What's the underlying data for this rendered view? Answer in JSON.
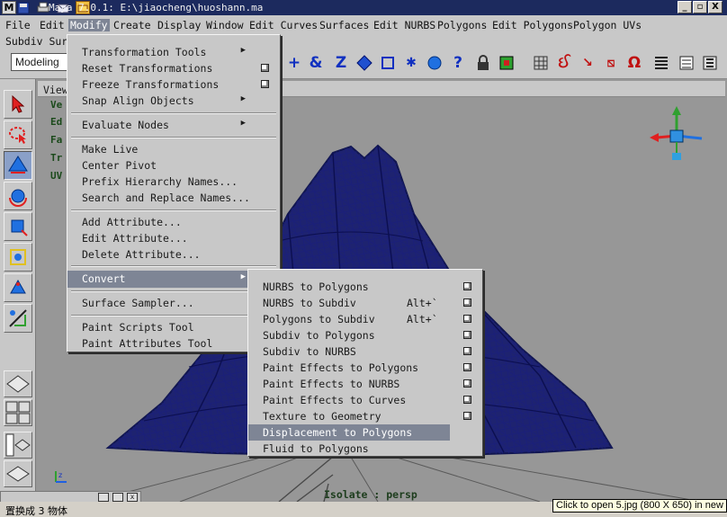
{
  "window": {
    "title": "Maya 7.0.1: E:\\jiaocheng\\huoshann.ma",
    "controls": [
      "_",
      "▫",
      "X"
    ]
  },
  "menubar": {
    "items": [
      "File",
      "Edit",
      "Modify",
      "Create",
      "Display",
      "Window",
      "Edit Curves",
      "Surfaces",
      "Edit NURBS",
      "Polygons",
      "Edit Polygons",
      "Polygon UVs"
    ],
    "row2": [
      "Subdiv Surf"
    ]
  },
  "shelf": {
    "mode": "Modeling"
  },
  "viewport": {
    "menu_label": "View",
    "hud": [
      "Ve",
      "Ed",
      "Fa",
      "Tr",
      "UV"
    ],
    "isolate_label": "Isolate : persp"
  },
  "modify_menu": {
    "groups": [
      [
        {
          "label": "Transformation Tools",
          "submenu": true
        },
        {
          "label": "Reset Transformations",
          "option": true
        },
        {
          "label": "Freeze Transformations",
          "option": true
        },
        {
          "label": "Snap Align Objects",
          "submenu": true
        }
      ],
      [
        {
          "label": "Evaluate Nodes",
          "submenu": true
        }
      ],
      [
        {
          "label": "Make Live"
        },
        {
          "label": "Center Pivot"
        },
        {
          "label": "Prefix Hierarchy Names..."
        },
        {
          "label": "Search and Replace Names..."
        }
      ],
      [
        {
          "label": "Add Attribute..."
        },
        {
          "label": "Edit Attribute..."
        },
        {
          "label": "Delete Attribute..."
        }
      ],
      [
        {
          "label": "Convert",
          "submenu": true,
          "highlighted": true
        }
      ],
      [
        {
          "label": "Surface Sampler..."
        }
      ],
      [
        {
          "label": "Paint Scripts Tool"
        },
        {
          "label": "Paint Attributes Tool"
        }
      ]
    ]
  },
  "convert_submenu": {
    "items": [
      {
        "label": "NURBS to Polygons",
        "option": true
      },
      {
        "label": "NURBS to Subdiv",
        "hotkey": "Alt+`",
        "option": true
      },
      {
        "label": "Polygons to Subdiv",
        "hotkey": "Alt+`",
        "option": true
      },
      {
        "label": "Subdiv to Polygons",
        "option": true
      },
      {
        "label": "Subdiv to NURBS",
        "option": true
      },
      {
        "label": "Paint Effects to Polygons",
        "option": true
      },
      {
        "label": "Paint Effects to NURBS",
        "option": true
      },
      {
        "label": "Paint Effects to Curves",
        "option": true
      },
      {
        "label": "Texture to Geometry",
        "option": true
      },
      {
        "label": "Displacement to Polygons",
        "highlighted": true
      },
      {
        "label": "Fluid to Polygons"
      }
    ]
  },
  "status": {
    "text": "置换成 3 物体",
    "tooltip": "Click to open 5.jpg (800 X 650) in new window"
  },
  "colors": {
    "wireframe": "#1a1f7a",
    "highlight": "#7e8595",
    "menu_bg": "#c8c8c8",
    "viewport_bg": "#979797"
  }
}
